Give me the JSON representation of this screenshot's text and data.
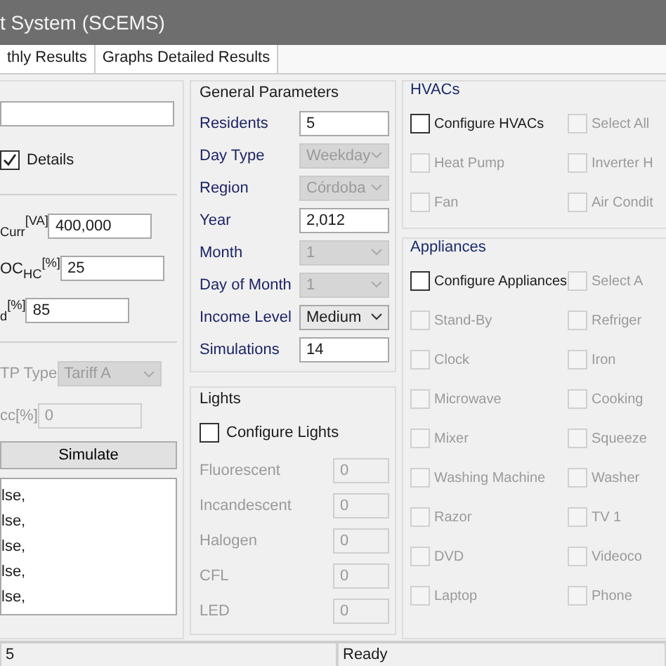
{
  "window": {
    "title": "t System (SCEMS)"
  },
  "tabs": [
    {
      "label": "thly Results",
      "selected": false
    },
    {
      "label": "Graphs Detailed Results",
      "selected": false
    }
  ],
  "left_panel": {
    "details": {
      "label": "Details",
      "checked": true
    },
    "demand_fields": [
      {
        "label": "$_{Curr}$$^{[VA]}$",
        "value": "400,000",
        "kind": "input",
        "disabled": false
      },
      {
        "label": "OC$_{HC}$$^{[%]}$",
        "value": "25",
        "kind": "input",
        "disabled": false
      },
      {
        "label": "$_{d}$$^{[%]}$",
        "value": "85",
        "kind": "input",
        "disabled": false
      }
    ],
    "tariff_fields": [
      {
        "label": "TP Type",
        "value": "Tariff A",
        "kind": "dropdown",
        "disabled": true
      },
      {
        "label": "cc[%]",
        "value": "0",
        "kind": "input",
        "disabled": true
      }
    ],
    "simulate_button": "Simulate",
    "output_lines": [
      "lse,",
      "lse,",
      "lse,",
      "lse,",
      "lse,"
    ]
  },
  "general_parameters": {
    "title": "General Parameters",
    "rows": [
      {
        "label": "Residents",
        "value": "5",
        "kind": "input",
        "disabled": false
      },
      {
        "label": "Day Type",
        "value": "Weekday",
        "kind": "dropdown",
        "disabled": true
      },
      {
        "label": "Region",
        "value": "Córdoba",
        "kind": "dropdown",
        "disabled": true
      },
      {
        "label": "Year",
        "value": "2,012",
        "kind": "input",
        "disabled": false
      },
      {
        "label": "Month",
        "value": "1",
        "kind": "dropdown",
        "disabled": true
      },
      {
        "label": "Day of Month",
        "value": "1",
        "kind": "dropdown",
        "disabled": true
      },
      {
        "label": "Income Level",
        "value": "Medium",
        "kind": "dropdown",
        "disabled": false
      },
      {
        "label": "Simulations",
        "value": "14",
        "kind": "input",
        "disabled": false
      }
    ]
  },
  "lights": {
    "title": "Lights",
    "configure": {
      "label": "Configure Lights",
      "checked": false
    },
    "items": [
      {
        "label": "Fluorescent",
        "value": "0",
        "disabled": true
      },
      {
        "label": "Incandescent",
        "value": "0",
        "disabled": true
      },
      {
        "label": "Halogen",
        "value": "0",
        "disabled": true
      },
      {
        "label": "CFL",
        "value": "0",
        "disabled": true
      },
      {
        "label": "LED",
        "value": "0",
        "disabled": true
      }
    ]
  },
  "hvacs": {
    "title": "HVACs",
    "configure": {
      "label": "Configure HVACs",
      "checked": false
    },
    "select_all": {
      "label": "Select All",
      "checked": false,
      "disabled": true
    },
    "items": [
      {
        "label": "Heat Pump",
        "checked": false,
        "disabled": true
      },
      {
        "label": "Inverter H",
        "checked": false,
        "disabled": true
      },
      {
        "label": "Fan",
        "checked": false,
        "disabled": true
      },
      {
        "label": "Air Condit",
        "checked": false,
        "disabled": true
      }
    ]
  },
  "appliances": {
    "title": "Appliances",
    "configure": {
      "label": "Configure Appliances",
      "checked": false
    },
    "select_all": {
      "label": "Select A",
      "checked": false,
      "disabled": true
    },
    "items": [
      {
        "label": "Stand-By",
        "checked": false,
        "disabled": true
      },
      {
        "label": "Refriger",
        "checked": false,
        "disabled": true
      },
      {
        "label": "Clock",
        "checked": false,
        "disabled": true
      },
      {
        "label": "Iron",
        "checked": false,
        "disabled": true
      },
      {
        "label": "Microwave",
        "checked": false,
        "disabled": true
      },
      {
        "label": "Cooking",
        "checked": false,
        "disabled": true
      },
      {
        "label": "Mixer",
        "checked": false,
        "disabled": true
      },
      {
        "label": "Squeeze",
        "checked": false,
        "disabled": true
      },
      {
        "label": "Washing Machine",
        "checked": false,
        "disabled": true
      },
      {
        "label": "Washer",
        "checked": false,
        "disabled": true
      },
      {
        "label": "Razor",
        "checked": false,
        "disabled": true
      },
      {
        "label": "TV 1",
        "checked": false,
        "disabled": true
      },
      {
        "label": "DVD",
        "checked": false,
        "disabled": true
      },
      {
        "label": "Videoco",
        "checked": false,
        "disabled": true
      },
      {
        "label": "Laptop",
        "checked": false,
        "disabled": true
      },
      {
        "label": "Phone",
        "checked": false,
        "disabled": true
      }
    ]
  },
  "status_bar": [
    "5",
    "Ready"
  ]
}
